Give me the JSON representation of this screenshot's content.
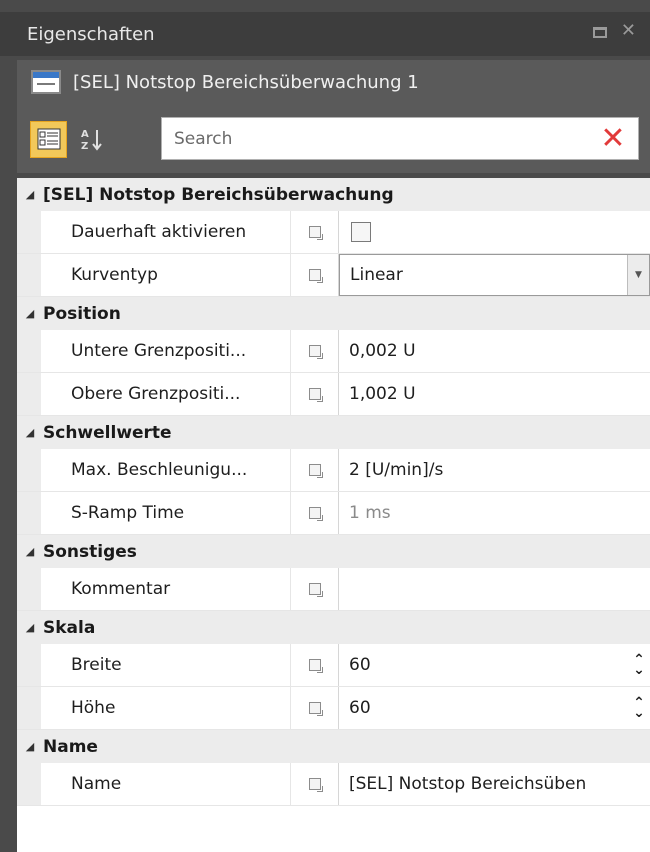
{
  "window": {
    "title": "Eigenschaften",
    "maximize_icon": "maximize-icon",
    "close_glyph": "✕"
  },
  "object": {
    "name": "[SEL] Notstop Bereichsüberwachung 1",
    "icon": "object-icon"
  },
  "toolbar": {
    "search_placeholder": "Search",
    "categorized_icon": "categorized-icon",
    "sort_icon": "sort-az-icon",
    "clear_glyph": "✕"
  },
  "categories": [
    {
      "label": "[SEL] Notstop Bereichsüberwachung",
      "rows": [
        {
          "name": "Dauerhaft aktivieren",
          "type": "checkbox",
          "checked": false
        },
        {
          "name": "Kurventyp",
          "type": "dropdown",
          "value": "Linear"
        }
      ]
    },
    {
      "label": "Position",
      "rows": [
        {
          "name": "Untere Grenzpositi...",
          "value": "0,002 U"
        },
        {
          "name": "Obere Grenzpositi...",
          "value": "1,002 U"
        }
      ]
    },
    {
      "label": "Schwellwerte",
      "rows": [
        {
          "name": "Max. Beschleunigu...",
          "value": "2 [U/min]/s"
        },
        {
          "name": "S-Ramp Time",
          "value": "1 ms",
          "muted": true
        }
      ]
    },
    {
      "label": "Sonstiges",
      "rows": [
        {
          "name": "Kommentar",
          "value": ""
        }
      ]
    },
    {
      "label": "Skala",
      "rows": [
        {
          "name": "Breite",
          "value": "60",
          "type": "spin"
        },
        {
          "name": "Höhe",
          "value": "60",
          "type": "spin"
        }
      ]
    },
    {
      "label": "Name",
      "rows": [
        {
          "name": "Name",
          "value": "[SEL] Notstop Bereichsüben"
        }
      ]
    }
  ],
  "glyphs": {
    "expanded": "◢",
    "dropdown_arrow": "▼",
    "spin_up": "⌃",
    "spin_down": "⌄"
  },
  "colors": {
    "accent": "#f2c85a",
    "clear": "#e23a3a",
    "header_bg": "#3d3d3d"
  }
}
